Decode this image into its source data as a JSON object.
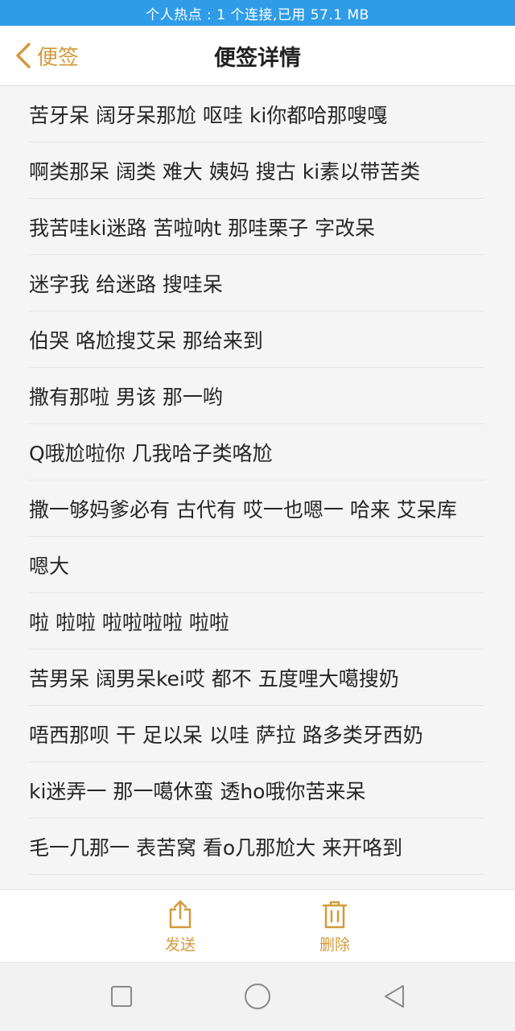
{
  "status_bar": {
    "text": "个人热点 : 1 个连接,已用 57.1 MB"
  },
  "nav": {
    "back_label": "便签",
    "title": "便签详情"
  },
  "note_lines": [
    "苦牙呆 阔牙呆那尬 呕哇 ki你都哈那嗖嘎",
    "啊类那呆 阔类 难大 姨妈 搜古 ki素以带苦类",
    "我苦哇ki迷路 苦啦呐t 那哇栗子 字改呆",
    "迷字我 给迷路 搜哇呆",
    "伯哭 咯尬搜艾呆 那给来到",
    "撒有那啦 男该 那一哟",
    "Q哦尬啦你 几我哈子类咯尬",
    "撒一够妈爹必有 古代有 哎一也嗯一 哈来 艾呆库",
    "嗯大",
    "啦 啦啦 啦啦啦啦 啦啦",
    "苦男呆 阔男呆kei哎 都不 五度哩大噶搜奶",
    "唔西那呗 干 足以呆 以哇 萨拉 路多类牙西奶",
    "ki迷弄一 那一噶休蛮 透ho哦你苦来呆",
    "毛一几那一 表苦窝 看o几那尬大 来开咯到"
  ],
  "toolbar": {
    "send_label": "发送",
    "delete_label": "删除"
  },
  "colors": {
    "accent": "#d39a3a",
    "status_bar_bg": "#2f9ce8"
  },
  "icons": {
    "back": "chevron-left-icon",
    "send": "share-icon",
    "delete": "trash-icon",
    "recents": "square-icon",
    "home": "circle-icon",
    "back_sys": "triangle-back-icon"
  }
}
